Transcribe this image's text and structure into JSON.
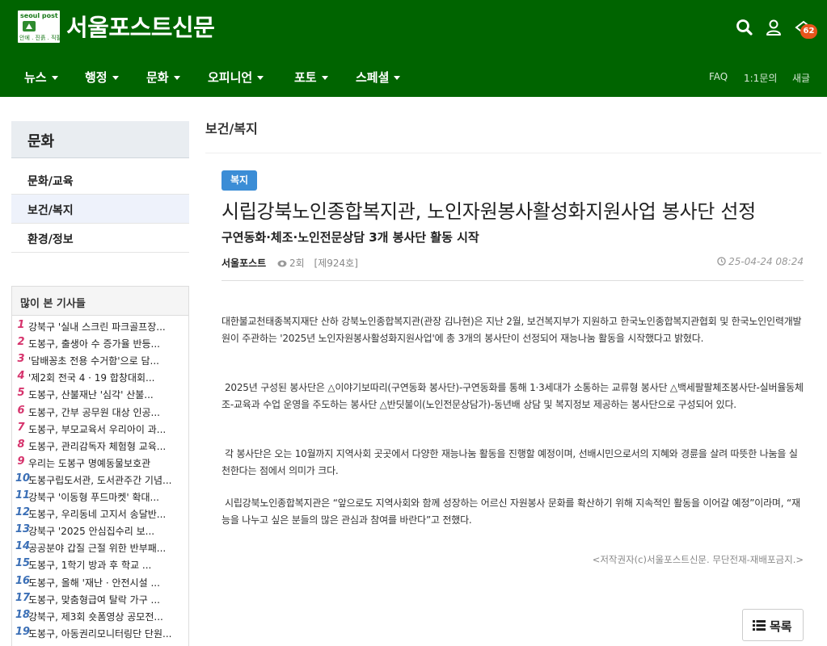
{
  "header": {
    "logo_top_text": "seoul post",
    "logo_bottom_text": "안에 . 진흙 . 직필",
    "site_title": "서울포스트신문",
    "notification_count": "62",
    "icons": [
      "search-icon",
      "user-icon",
      "notification-icon"
    ],
    "brand_color": "#006400"
  },
  "nav": {
    "items": [
      {
        "label": "뉴스"
      },
      {
        "label": "행정"
      },
      {
        "label": "문화"
      },
      {
        "label": "오피니언"
      },
      {
        "label": "포토"
      },
      {
        "label": "스페셜"
      }
    ],
    "util": [
      "FAQ",
      "1:1문의",
      "새글"
    ]
  },
  "sidebar": {
    "heading": "문화",
    "items": [
      {
        "label": "문화/교육",
        "active": false
      },
      {
        "label": "보건/복지",
        "active": true
      },
      {
        "label": "환경/정보",
        "active": false
      }
    ],
    "popular_title": "많이 본 기사들",
    "popular": [
      {
        "num": "1",
        "text": "강북구 '실내 스크린 파크골프장..."
      },
      {
        "num": "2",
        "text": "도봉구, 출생아 수 증가율 반등..."
      },
      {
        "num": "3",
        "text": "'담배꽁초 전용 수거함'으로 담..."
      },
      {
        "num": "4",
        "text": "'제2회 전국 4 · 19 합창대회..."
      },
      {
        "num": "5",
        "text": "도봉구, 산불재난 '심각' 산불..."
      },
      {
        "num": "6",
        "text": "도봉구, 간부 공무원 대상 인공..."
      },
      {
        "num": "7",
        "text": "도봉구, 부모교육서 우리아이 과..."
      },
      {
        "num": "8",
        "text": "도봉구, 관리감독자 체험형 교육..."
      },
      {
        "num": "9",
        "text": "우리는 도봉구 명예동물보호관"
      },
      {
        "num": "10",
        "text": "도봉구립도서관, 도서관주간 기념..."
      },
      {
        "num": "11",
        "text": "강북구 '이동형 푸드마켓' 확대..."
      },
      {
        "num": "12",
        "text": "도봉구, 우리동네 고지서 송달반..."
      },
      {
        "num": "13",
        "text": "강북구 '2025 안심집수리 보..."
      },
      {
        "num": "14",
        "text": "공공분야 갑질 근절 위한 반부패..."
      },
      {
        "num": "15",
        "text": "도봉구, 1학기 방과 후 학교 ..."
      },
      {
        "num": "16",
        "text": "도봉구, 올해 '재난 · 안전시설 ..."
      },
      {
        "num": "17",
        "text": "도봉구, 맞춤형급여 탈락 가구 ..."
      },
      {
        "num": "18",
        "text": "강북구, 제3회 숏폼영상 공모전..."
      },
      {
        "num": "19",
        "text": "도봉구, 아동권리모니터링단 단원..."
      }
    ]
  },
  "article": {
    "section": "보건/복지",
    "category": "복지",
    "title": "시립강북노인종합복지관, 노인자원봉사활성화지원사업 봉사단 선정",
    "subtitle": "구연동화·체조·노인전문상담 3개 봉사단 활동 시작",
    "author": "서울포스트",
    "views": "2회",
    "issue": "[제924호]",
    "date": "25-04-24 08:24",
    "paragraphs": [
      "대한불교천태종복지재단 산하 강북노인종합복지관(관장 김나현)은 지난 2월, 보건복지부가 지원하고 한국노인종합복지관협회 및 한국노인인력개발원이 주관하는 '2025년 노인자원봉사활성화지원사업'에 총 3개의 봉사단이 선정되어 재능나눔 활동을 시작했다고 밝혔다.",
      "2025년 구성된 봉사단은 △이야기보따리(구연동화 봉사단)-구연동화를 통해 1·3세대가 소통하는 교류형 봉사단 △백세팔팔체조봉사단-실버율동체조-교육과 수업 운영을 주도하는 봉사단 △반딧불이(노인전문상담가)-동년배 상담 및 복지정보 제공하는 봉사단으로 구성되어 있다.",
      "각 봉사단은 오는 10월까지 지역사회 곳곳에서 다양한 재능나눔 활동을 진행할 예정이며, 선배시민으로서의 지혜와 경륜을 살려 따뜻한 나눔을 실천한다는 점에서 의미가 크다.",
      "시립강북노인종합복지관은 “앞으로도 지역사회와 함께 성장하는 어르신 자원봉사 문화를 확산하기 위해 지속적인 활동을 이어갈 예정”이라며, “재능을 나누고 싶은 분들의 많은 관심과 참여를 바란다”고 전했다."
    ],
    "copyright": "<저작권자(c)서울포스트신문. 무단전재-재배포금지.>",
    "list_button": "목록"
  }
}
